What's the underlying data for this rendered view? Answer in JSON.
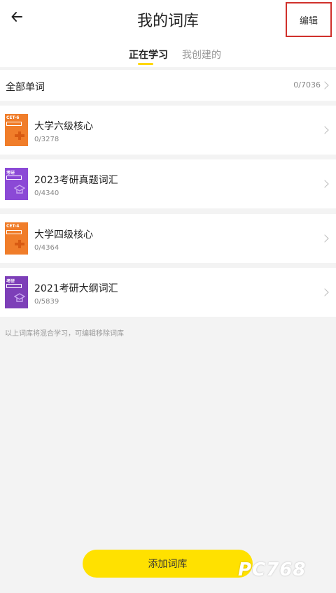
{
  "header": {
    "back_icon": "arrow-left-icon",
    "title": "我的词库",
    "edit_label": "编辑"
  },
  "tabs": [
    {
      "label": "正在学习",
      "active": true
    },
    {
      "label": "我创建的",
      "active": false
    }
  ],
  "all_words": {
    "label": "全部单词",
    "count": "0/7036"
  },
  "books": [
    {
      "name": "大学六级核心",
      "count": "0/3278",
      "cover_tag": "CET-6",
      "cover_color": "#f07d2a",
      "cover_icon": "cet-cover-icon"
    },
    {
      "name": "2023考研真题词汇",
      "count": "0/4340",
      "cover_tag": "考研",
      "cover_color": "#8b49d6",
      "cover_icon": "graduation-cap-icon"
    },
    {
      "name": "大学四级核心",
      "count": "0/4364",
      "cover_tag": "CET-4",
      "cover_color": "#f07d2a",
      "cover_icon": "cet-cover-icon"
    },
    {
      "name": "2021考研大纲词汇",
      "count": "0/5839",
      "cover_tag": "考研",
      "cover_color": "#7d3fb8",
      "cover_icon": "graduation-cap-icon"
    }
  ],
  "hint": "以上词库将混合学习，可编辑移除词库",
  "add_button_label": "添加词库",
  "watermark": "PC768",
  "colors": {
    "accent_yellow": "#ffe100",
    "highlight_box": "#d0302b",
    "orange_cover": "#f07d2a",
    "purple_cover": "#8b49d6"
  }
}
